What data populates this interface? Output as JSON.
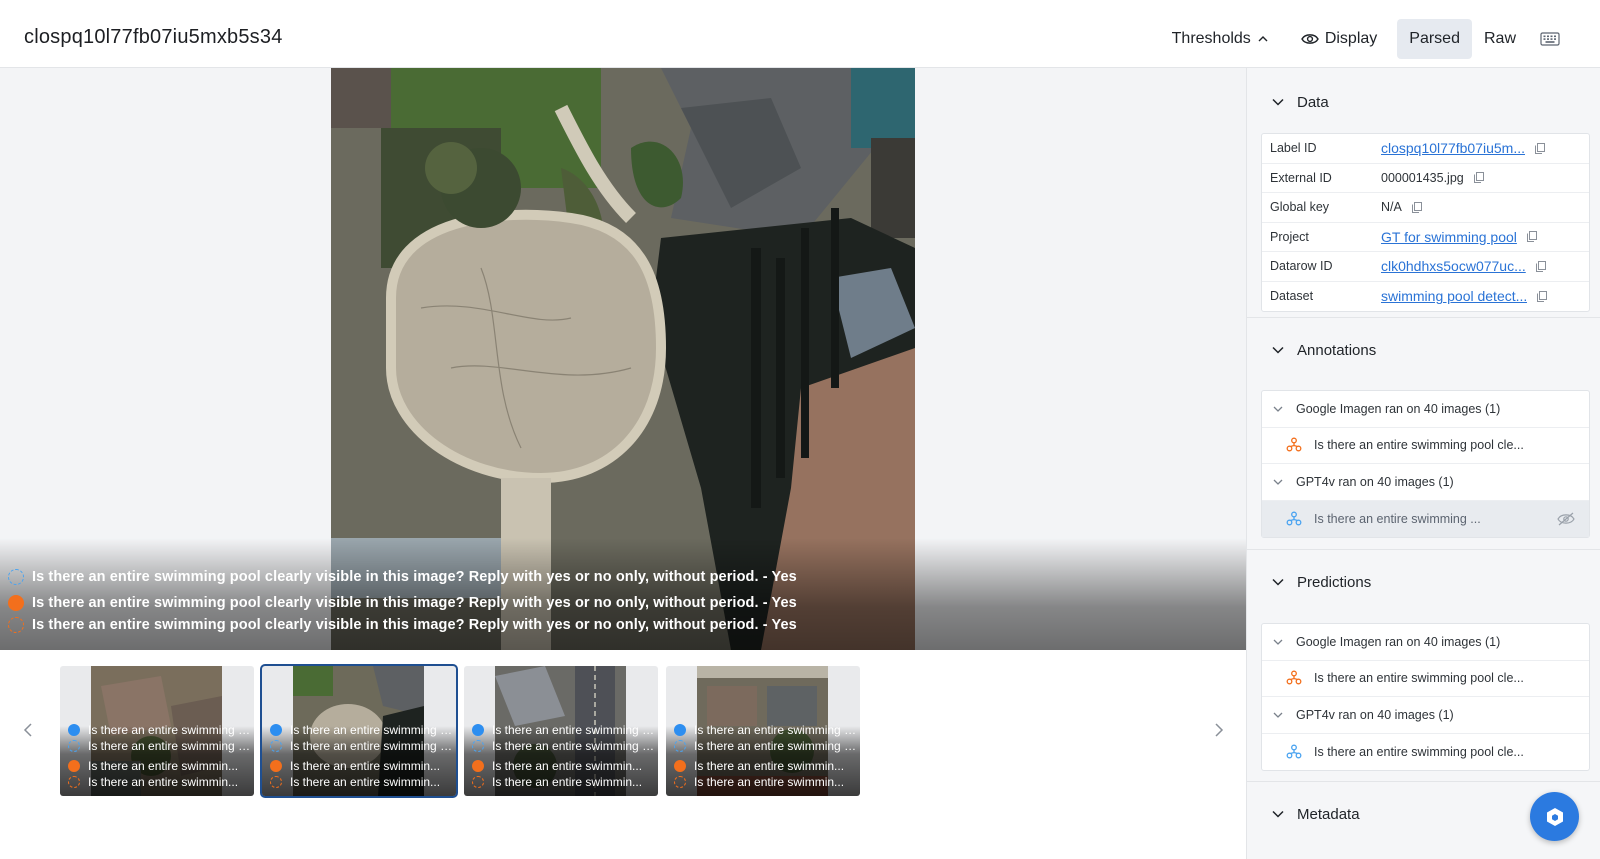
{
  "header": {
    "title": "clospq10l77fb07iu5mxb5s34",
    "toolbar": {
      "thresholds_label": "Thresholds",
      "display_label": "Display",
      "parsed_label": "Parsed",
      "raw_label": "Raw",
      "active_tab": "Parsed"
    }
  },
  "viewer": {
    "captions": [
      {
        "style": "dashed-blue",
        "text": "Is there an entire swimming pool clearly visible in this image? Reply with yes or no only, without period. - Yes"
      },
      {
        "style": "solid-orange",
        "text": "Is there an entire swimming pool clearly visible in this image? Reply with yes or no only, without period. - Yes"
      },
      {
        "style": "dashed-orange",
        "text": "Is there an entire swimming pool clearly visible in this image? Reply with yes or no only, without period. - Yes"
      }
    ]
  },
  "thumbnails": {
    "selected_index": 1,
    "items": [
      {
        "captions": [
          "Is there an entire swimming pool",
          "Is there an entire swimming pool",
          "Is there an entire swimmin...",
          "Is there an entire swimmin..."
        ]
      },
      {
        "captions": [
          "Is there an entire swimming pool",
          "Is there an entire swimming pool",
          "Is there an entire swimmin...",
          "Is there an entire swimmin..."
        ]
      },
      {
        "captions": [
          "Is there an entire swimming pool",
          "Is there an entire swimming pool",
          "Is there an entire swimmin...",
          "Is there an entire swimmin..."
        ]
      },
      {
        "captions": [
          "Is there an entire swimming pool",
          "Is there an entire swimming pool",
          "Is there an entire swimmin...",
          "Is there an entire swimmin..."
        ]
      }
    ]
  },
  "sidebar": {
    "data": {
      "heading": "Data",
      "rows": [
        {
          "key": "Label ID",
          "value": "clospq10l77fb07iu5m...",
          "link": true
        },
        {
          "key": "External ID",
          "value": "000001435.jpg",
          "link": false
        },
        {
          "key": "Global key",
          "value": "N/A",
          "link": false
        },
        {
          "key": "Project",
          "value": "GT for swimming pool",
          "link": true
        },
        {
          "key": "Datarow ID",
          "value": "clk0hdhxs5ocw077uc...",
          "link": true
        },
        {
          "key": "Dataset",
          "value": "swimming pool detect...",
          "link": true
        }
      ]
    },
    "annotations": {
      "heading": "Annotations",
      "groups": [
        {
          "label": "Google Imagen ran on 40 images (1)",
          "item": "Is there an entire swimming pool cle...",
          "color": "#f36f1c",
          "hidden": false
        },
        {
          "label": "GPT4v ran on 40 images (1)",
          "item": "Is there an entire swimming ...",
          "color": "#4aa3f0",
          "hidden": true
        }
      ]
    },
    "predictions": {
      "heading": "Predictions",
      "groups": [
        {
          "label": "Google Imagen ran on 40 images (1)",
          "item": "Is there an entire swimming pool cle...",
          "color": "#f36f1c",
          "hidden": false
        },
        {
          "label": "GPT4v ran on 40 images (1)",
          "item": "Is there an entire swimming pool cle...",
          "color": "#4aa3f0",
          "hidden": false
        }
      ]
    },
    "metadata": {
      "heading": "Metadata"
    }
  },
  "colors": {
    "accent": "#2a73d6",
    "orange": "#f36f1c",
    "blue": "#4aa3f0",
    "selected_border": "#1f4f91"
  }
}
